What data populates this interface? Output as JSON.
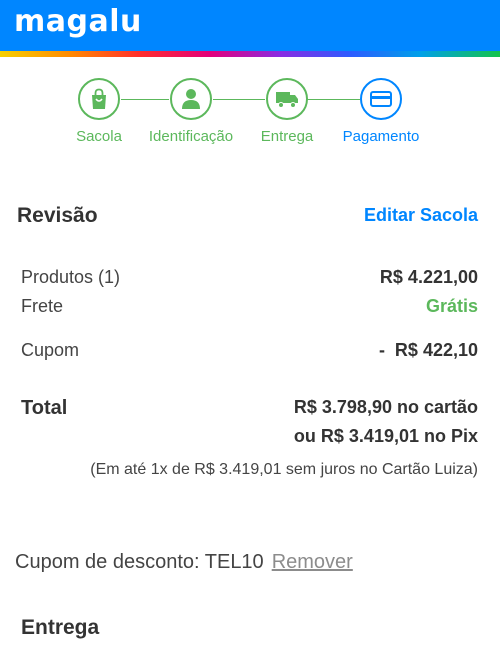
{
  "header": {
    "logo": "magalu",
    "bg_color": "#0086ff"
  },
  "steps": [
    {
      "label": "Sacola",
      "icon": "shopping-bag-icon",
      "state": "done"
    },
    {
      "label": "Identificação",
      "icon": "user-icon",
      "state": "done"
    },
    {
      "label": "Entrega",
      "icon": "truck-icon",
      "state": "done"
    },
    {
      "label": "Pagamento",
      "icon": "credit-card-icon",
      "state": "active"
    }
  ],
  "colors": {
    "done": "#5cb85c",
    "active": "#0086ff",
    "link": "#0086ff"
  },
  "review": {
    "title": "Revisão",
    "edit_link": "Editar Sacola",
    "products_label": "Produtos (1)",
    "products_value": "R$ 4.221,00",
    "shipping_label": "Frete",
    "shipping_value": "Grátis",
    "coupon_label": "Cupom",
    "coupon_value": "-  R$ 422,10",
    "total_label": "Total",
    "total_card": "R$ 3.798,90 no cartão",
    "total_pix": "ou R$ 3.419,01 no Pix",
    "installment_note": "(Em até 1x de R$ 3.419,01 sem juros no Cartão Luiza)"
  },
  "coupon": {
    "text": "Cupom de desconto: TEL10",
    "remove_label": "Remover"
  },
  "delivery": {
    "title": "Entrega"
  }
}
